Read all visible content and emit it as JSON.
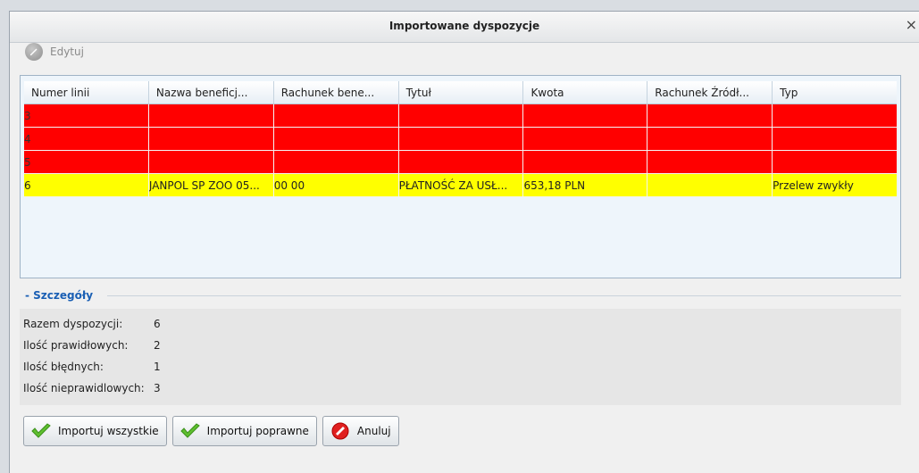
{
  "dialog": {
    "title": "Importowane dyspozycje",
    "close_glyph": "×"
  },
  "toolbar": {
    "edit_label": "Edytuj",
    "edit_icon": "edit-icon"
  },
  "grid": {
    "columns": [
      "Numer linii",
      "Nazwa beneficj...",
      "Rachunek bene...",
      "Tytuł",
      "Kwota",
      "Rachunek Źródł...",
      "Typ"
    ],
    "rows": [
      {
        "status": "error",
        "color": "#ff0000",
        "cells": [
          "3",
          "",
          "",
          "",
          "",
          "",
          ""
        ]
      },
      {
        "status": "error",
        "color": "#ff0000",
        "cells": [
          "4",
          "",
          "",
          "",
          "",
          "",
          ""
        ]
      },
      {
        "status": "error",
        "color": "#ff0000",
        "cells": [
          "5",
          "",
          "",
          "",
          "",
          "",
          ""
        ]
      },
      {
        "status": "warning",
        "color": "#ffff00",
        "cells": [
          "6",
          "JANPOL SP ZOO 05...",
          "00 00",
          "PŁATNOŚĆ ZA USŁ...",
          "653,18 PLN",
          "",
          "Przelew zwykły"
        ]
      }
    ]
  },
  "details": {
    "section_label": "- Szczegóły",
    "items": [
      {
        "label": "Razem dyspozycji:",
        "value": "6"
      },
      {
        "label": "Ilość prawidłowych:",
        "value": "2"
      },
      {
        "label": "Ilość błędnych:",
        "value": "1"
      },
      {
        "label": "Ilość nieprawidlowych:",
        "value": "3"
      }
    ]
  },
  "buttons": {
    "import_all": "Importuj wszystkie",
    "import_valid": "Importuj poprawne",
    "cancel": "Anuluj"
  },
  "colors": {
    "accent": "#1a5fb4",
    "error_row": "#ff0000",
    "warning_row": "#ffff00"
  }
}
